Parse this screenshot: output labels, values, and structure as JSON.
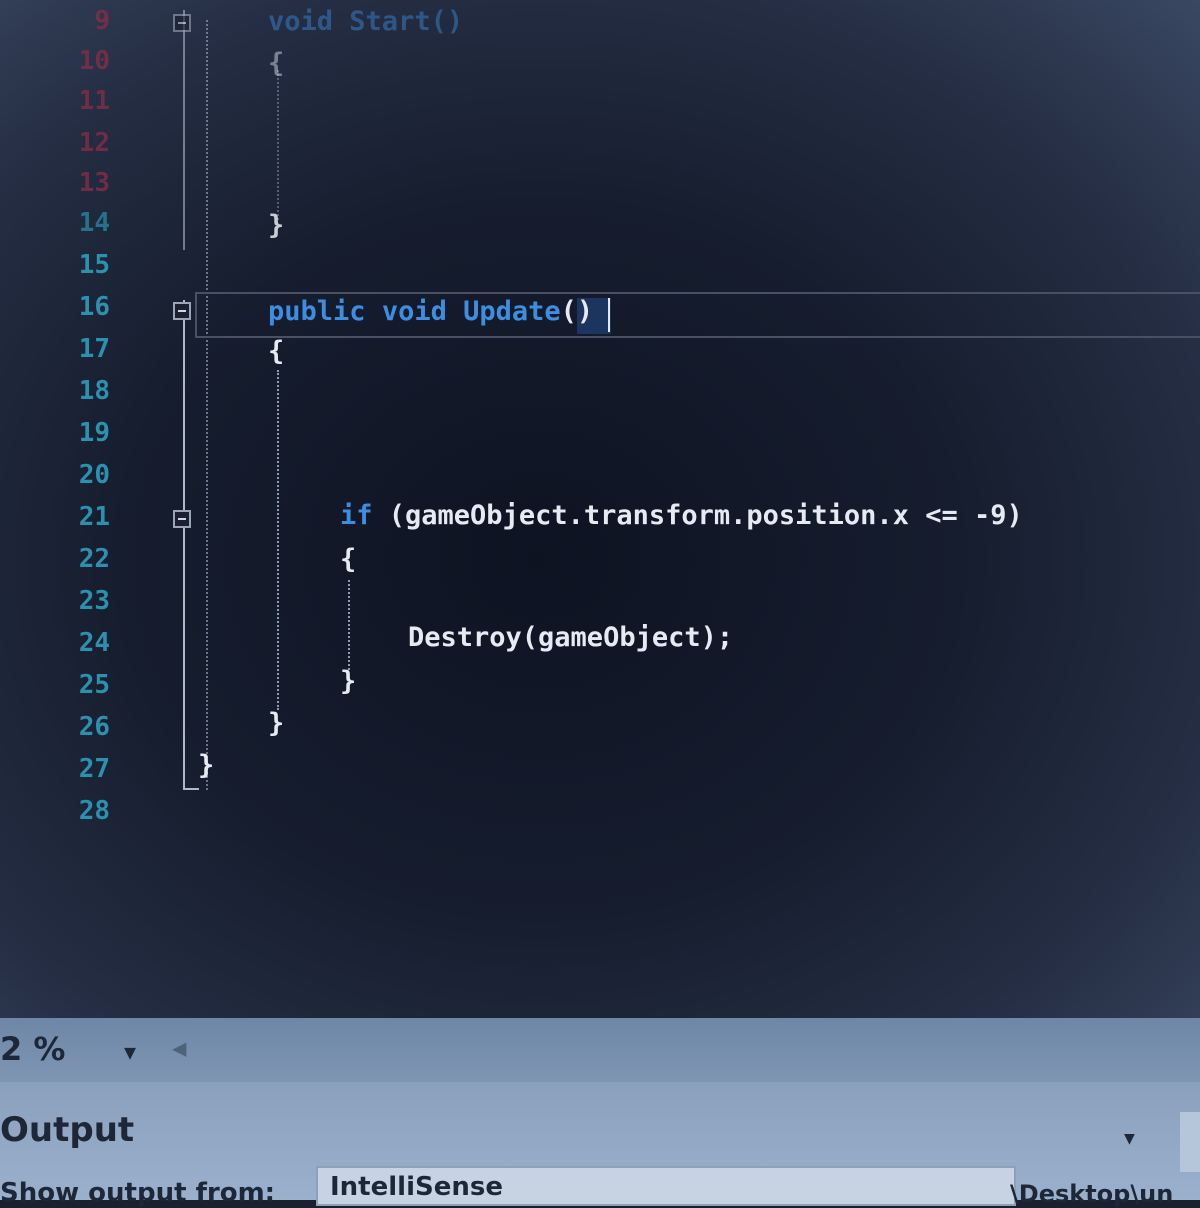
{
  "editor": {
    "line_numbers": [
      "9",
      "10",
      "11",
      "12",
      "13",
      "14",
      "15",
      "16",
      "17",
      "18",
      "19",
      "20",
      "21",
      "22",
      "23",
      "24",
      "25",
      "26",
      "27",
      "28"
    ],
    "code": {
      "start_void": "void",
      "start_name": "Start()",
      "open_brace_1": "{",
      "close_brace_1": "}",
      "update_public": "public",
      "update_void": "void",
      "update_name": "Update",
      "update_parens": "()",
      "open_brace_2": "{",
      "if_keyword": "if",
      "if_condition": " (gameObject.transform.position.x <= -9)",
      "open_brace_3": "{",
      "destroy_call": "Destroy(gameObject);",
      "close_brace_3": "}",
      "close_brace_2": "}",
      "close_brace_class": "}"
    }
  },
  "zoom": {
    "value": "2 %",
    "dropdown_icon": "chevron-down-icon"
  },
  "output_panel": {
    "title": "Output",
    "show_output_from_label": "Show output from:",
    "source_value": "IntelliSense",
    "path_text": "\\Desktop\\un"
  },
  "colors": {
    "keyword": "#3d8de0",
    "line_number": "#2b91af",
    "text": "#e6eaf2",
    "background": "#161d2e"
  }
}
